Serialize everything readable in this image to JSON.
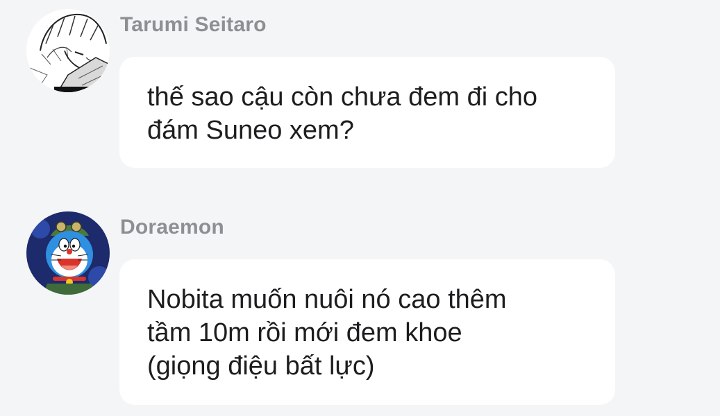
{
  "conversation": {
    "messages": [
      {
        "sender": "Tarumi Seitaro",
        "avatar_icon": "manga-boy-avatar",
        "lines": [
          "thế sao cậu còn chưa đem đi cho",
          "đám Suneo xem?"
        ]
      },
      {
        "sender": "Doraemon",
        "avatar_icon": "doraemon-avatar",
        "lines": [
          "Nobita muốn nuôi nó cao thêm",
          "tầm 10m rồi mới đem khoe",
          "(giọng điệu bất lực)"
        ]
      }
    ]
  },
  "colors": {
    "background": "#f4f5f7",
    "bubble": "#ffffff",
    "sender_name": "#8e8f93",
    "message_text": "#1d1d1f"
  }
}
